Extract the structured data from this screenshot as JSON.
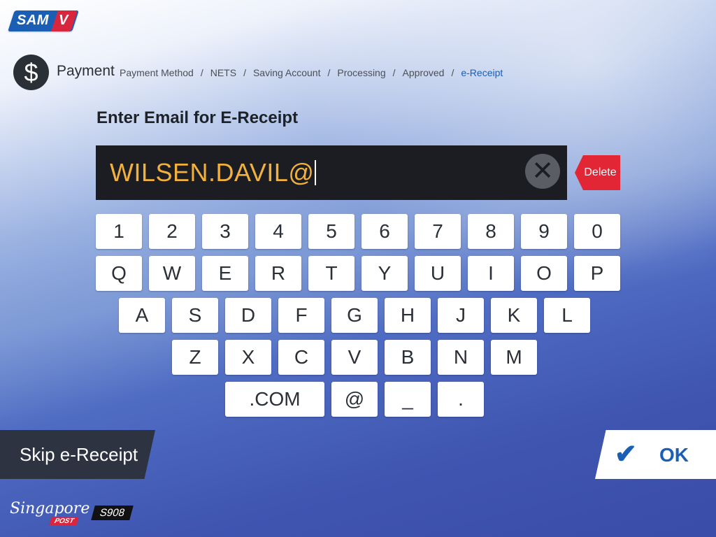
{
  "brand": {
    "logo_main": "SAM",
    "logo_v": "V"
  },
  "header": {
    "icon": "dollar-icon",
    "title": "Payment",
    "breadcrumb": [
      "Payment Method",
      "NETS",
      "Saving Account",
      "Processing",
      "Approved",
      "e-Receipt"
    ]
  },
  "prompt": "Enter Email for E-Receipt",
  "input": {
    "value": "WILSEN.DAVIL@"
  },
  "buttons": {
    "delete": "Delete",
    "skip": "Skip e-Receipt",
    "ok": "OK"
  },
  "keyboard": {
    "row1": [
      "1",
      "2",
      "3",
      "4",
      "5",
      "6",
      "7",
      "8",
      "9",
      "0"
    ],
    "row2": [
      "Q",
      "W",
      "E",
      "R",
      "T",
      "Y",
      "U",
      "I",
      "O",
      "P"
    ],
    "row3": [
      "A",
      "S",
      "D",
      "F",
      "G",
      "H",
      "J",
      "K",
      "L"
    ],
    "row4": [
      "Z",
      "X",
      "C",
      "V",
      "B",
      "N",
      "M"
    ],
    "row5": [
      ".COM",
      "@",
      "_",
      "."
    ]
  },
  "footer": {
    "brand_script": "Singapore",
    "brand_sub": "POST",
    "station": "S908"
  },
  "colors": {
    "accent": "#1a5fb4",
    "delete": "#e32636",
    "input_text": "#f2b13d"
  }
}
